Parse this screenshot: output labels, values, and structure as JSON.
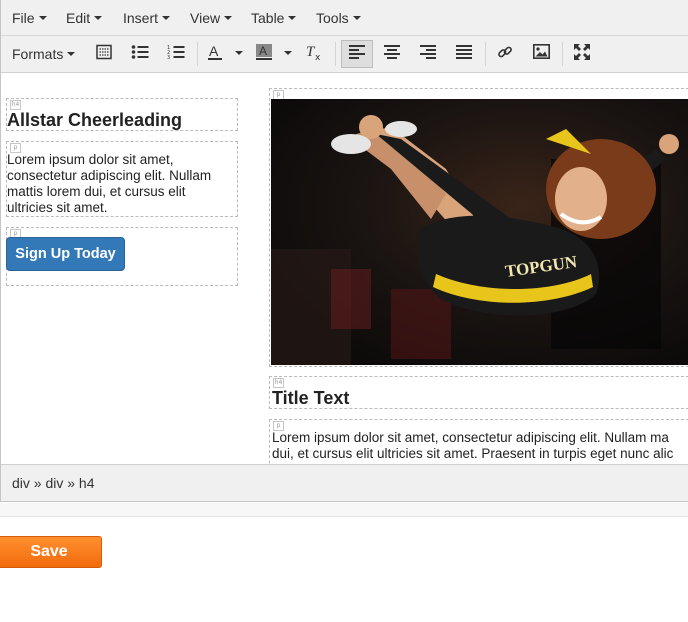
{
  "menubar": {
    "items": [
      "File",
      "Edit",
      "Insert",
      "View",
      "Table",
      "Tools"
    ]
  },
  "toolbar": {
    "formats_label": "Formats",
    "buttons": [
      {
        "icon": "source-code-icon"
      },
      {
        "icon": "bullet-list-icon"
      },
      {
        "icon": "numbered-list-icon"
      },
      {
        "icon": "text-color-icon"
      },
      {
        "icon": "background-color-icon"
      },
      {
        "icon": "clear-formatting-icon"
      },
      {
        "icon": "align-left-icon",
        "active": true
      },
      {
        "icon": "align-center-icon"
      },
      {
        "icon": "align-right-icon"
      },
      {
        "icon": "align-justify-icon"
      },
      {
        "icon": "link-icon"
      },
      {
        "icon": "image-icon"
      },
      {
        "icon": "fullscreen-icon"
      }
    ]
  },
  "content": {
    "left": {
      "heading": "Allstar Cheerleading",
      "paragraph": "Lorem ipsum dolor sit amet, consectetur adipiscing elit. Nullam mattis lorem dui, et cursus elit ultricies sit amet.",
      "button_label": "Sign Up Today"
    },
    "right": {
      "heading": "Title Text",
      "paragraph_line1": "Lorem ipsum dolor sit amet, consectetur adipiscing elit. Nullam ma",
      "paragraph_line2": "dui, et cursus elit ultricies sit amet. Praesent in turpis eget nunc alic",
      "photo_jersey_text": "TOPGUN"
    }
  },
  "statusbar": {
    "path": "div » div » h4"
  },
  "actions": {
    "save_label": "Save"
  },
  "colors": {
    "accent": "#3479b7",
    "save": "#f47a1c",
    "toolbar_bg": "#f0f0f0"
  }
}
